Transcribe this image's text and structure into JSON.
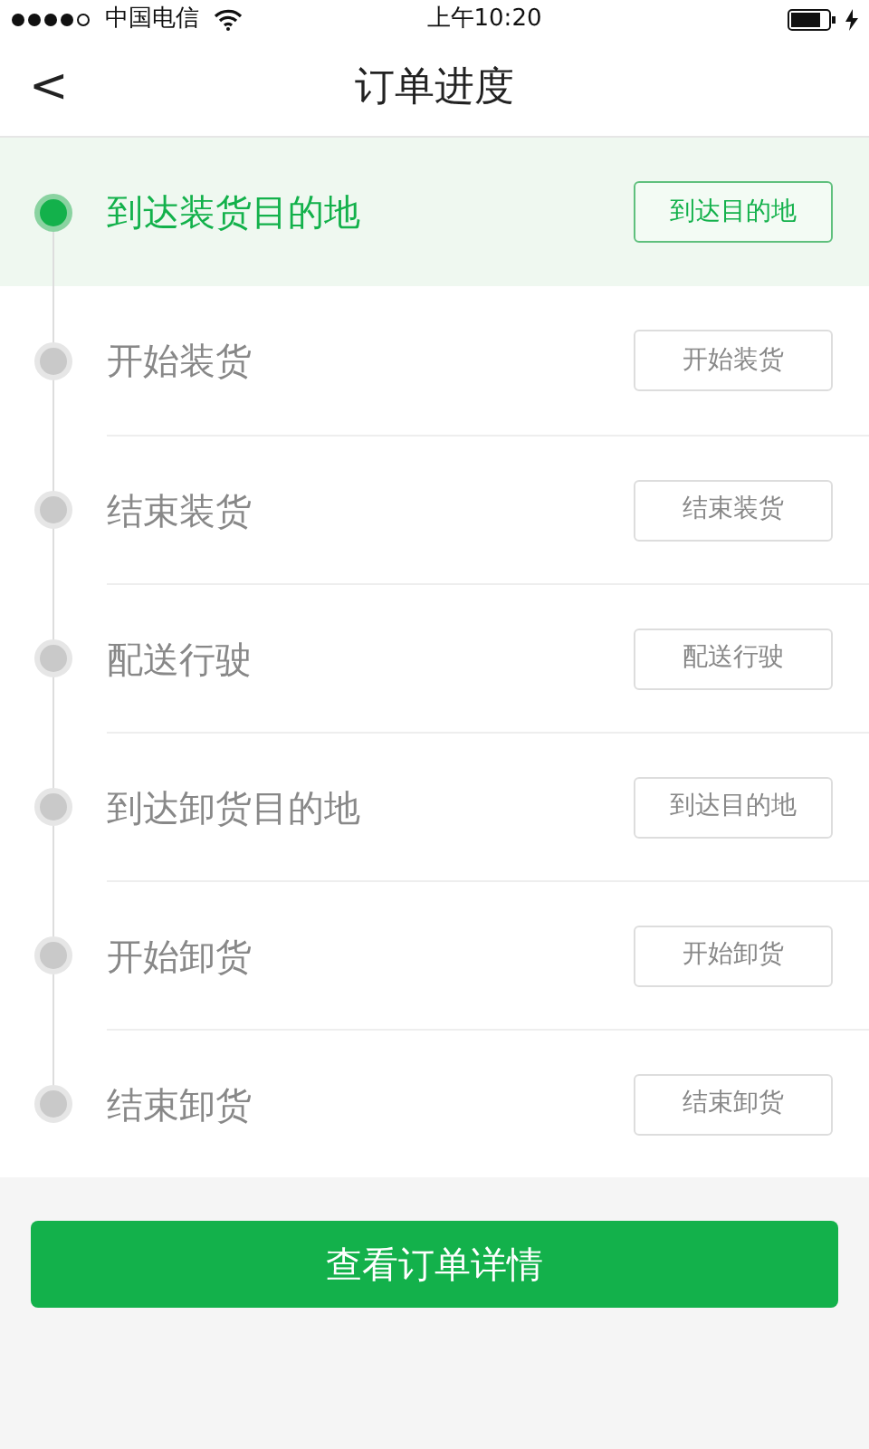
{
  "status_bar": {
    "carrier": "中国电信",
    "time": "上午10:20"
  },
  "header": {
    "back": "<",
    "title": "订单进度"
  },
  "steps": [
    {
      "label": "到达装货目的地",
      "button": "到达目的地",
      "active": true
    },
    {
      "label": "开始装货",
      "button": "开始装货",
      "active": false
    },
    {
      "label": "结束装货",
      "button": "结束装货",
      "active": false
    },
    {
      "label": "配送行驶",
      "button": "配送行驶",
      "active": false
    },
    {
      "label": "到达卸货目的地",
      "button": "到达目的地",
      "active": false
    },
    {
      "label": "开始卸货",
      "button": "开始卸货",
      "active": false
    },
    {
      "label": "结束卸货",
      "button": "结束卸货",
      "active": false
    }
  ],
  "action_button": "查看订单详情"
}
